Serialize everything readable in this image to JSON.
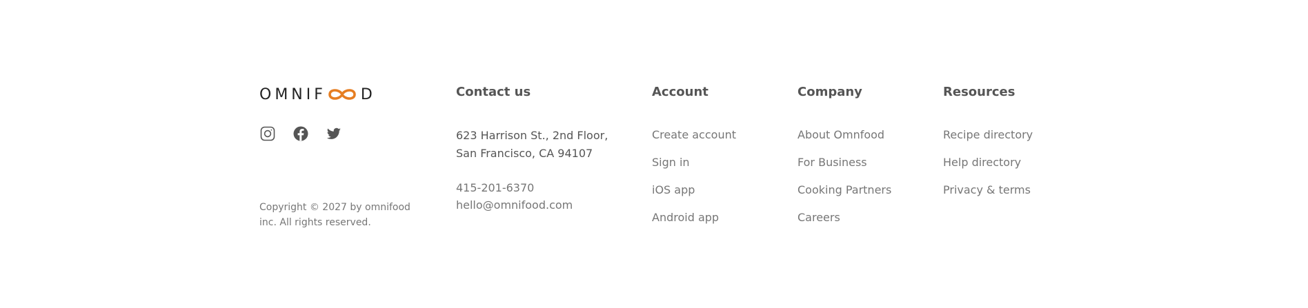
{
  "logo": {
    "text_left": "OMNIF",
    "text_right": "D",
    "accent_color": "#e67e22"
  },
  "social": [
    {
      "icon": "instagram-icon"
    },
    {
      "icon": "facebook-icon"
    },
    {
      "icon": "twitter-icon"
    }
  ],
  "copyright": "Copyright © 2027 by omnifood inc. All rights reserved.",
  "contact": {
    "heading": "Contact us",
    "address_line1": "623 Harrison St., 2nd Floor,",
    "address_line2": "San Francisco, CA 94107",
    "phone": "415-201-6370",
    "email": "hello@omnifood.com"
  },
  "account": {
    "heading": "Account",
    "links": [
      "Create account",
      "Sign in",
      "iOS app",
      "Android app"
    ]
  },
  "company": {
    "heading": "Company",
    "links": [
      "About Omnfood",
      "For Business",
      "Cooking Partners",
      "Careers"
    ]
  },
  "resources": {
    "heading": "Resources",
    "links": [
      "Recipe directory",
      "Help directory",
      "Privacy & terms"
    ]
  }
}
